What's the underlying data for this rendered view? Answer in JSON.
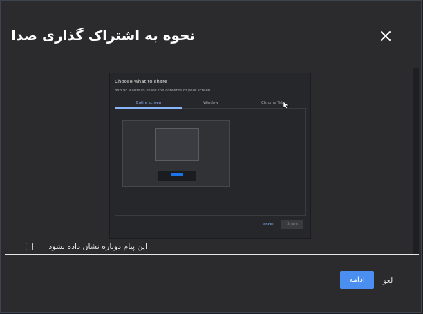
{
  "dialog": {
    "title": "نحوه به اشتراک گذاری صدا",
    "close_icon": "close-icon"
  },
  "preview": {
    "title": "Choose what to share",
    "subtitle": "8x8.vc wants to share the contents of your screen.",
    "tabs": [
      "Entire screen",
      "Window",
      "Chrome Tab"
    ],
    "active_tab": "Entire screen",
    "cancel_label": "Cancel",
    "share_label": "Share"
  },
  "options": {
    "dont_show_again": "این پیام دوباره نشان داده نشود",
    "checked": false
  },
  "footer": {
    "continue_label": "ادامه",
    "cancel_label": "لغو"
  },
  "colors": {
    "accent": "#4a8ff0",
    "background": "#2b2b2d"
  }
}
